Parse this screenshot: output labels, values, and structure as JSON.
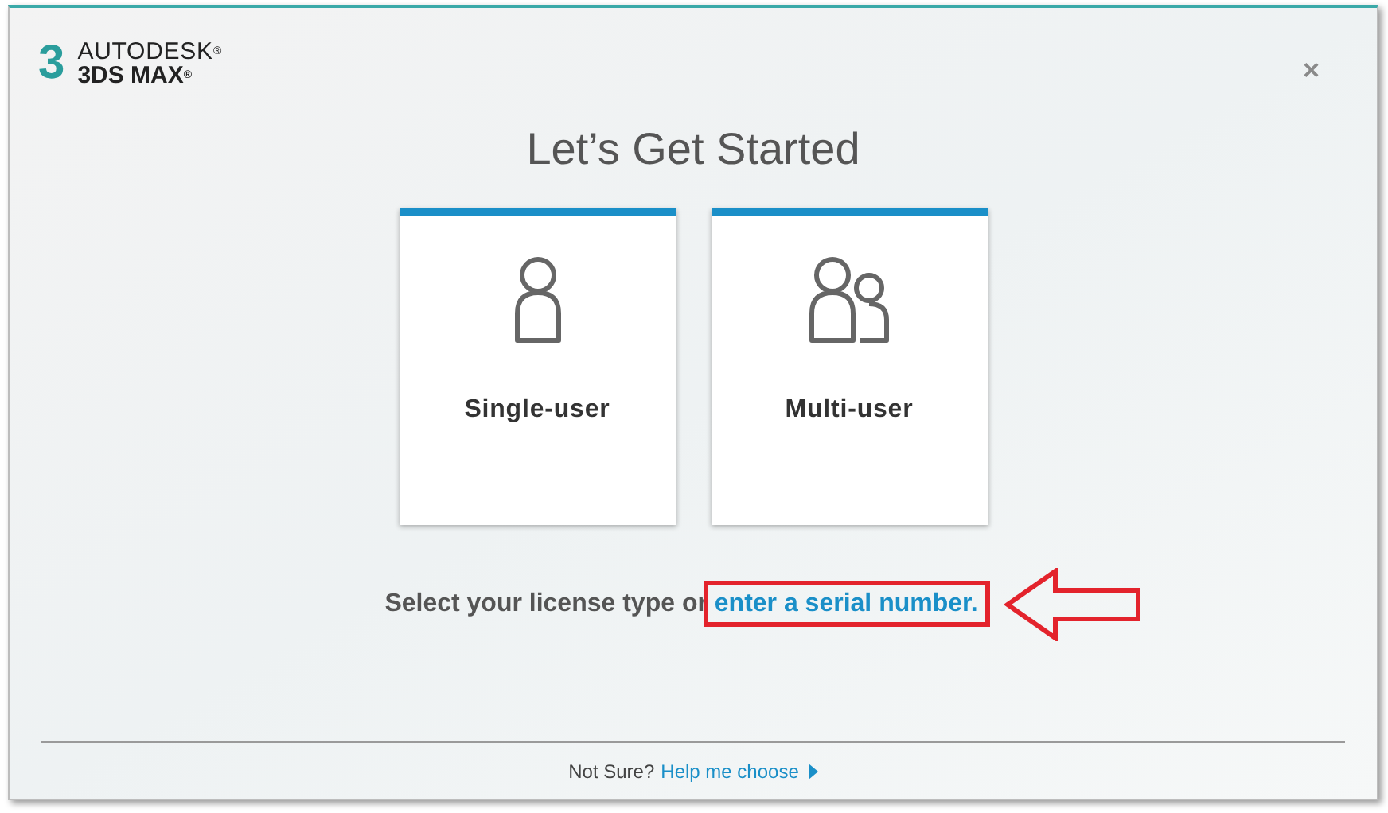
{
  "logo": {
    "mark": "3",
    "brand": "AUTODESK$^{®}$",
    "product": "3DS MAX$^{®}$"
  },
  "close": "×",
  "title": "Let’s Get Started",
  "options": [
    {
      "kind": "single",
      "label": "Single-user"
    },
    {
      "kind": "multi",
      "label": "Multi-user"
    }
  ],
  "prompt": {
    "text": "Select your license type or ",
    "link": "enter a serial number.",
    "highlight": true
  },
  "footer": {
    "text": "Not Sure?",
    "link": "Help me choose"
  }
}
